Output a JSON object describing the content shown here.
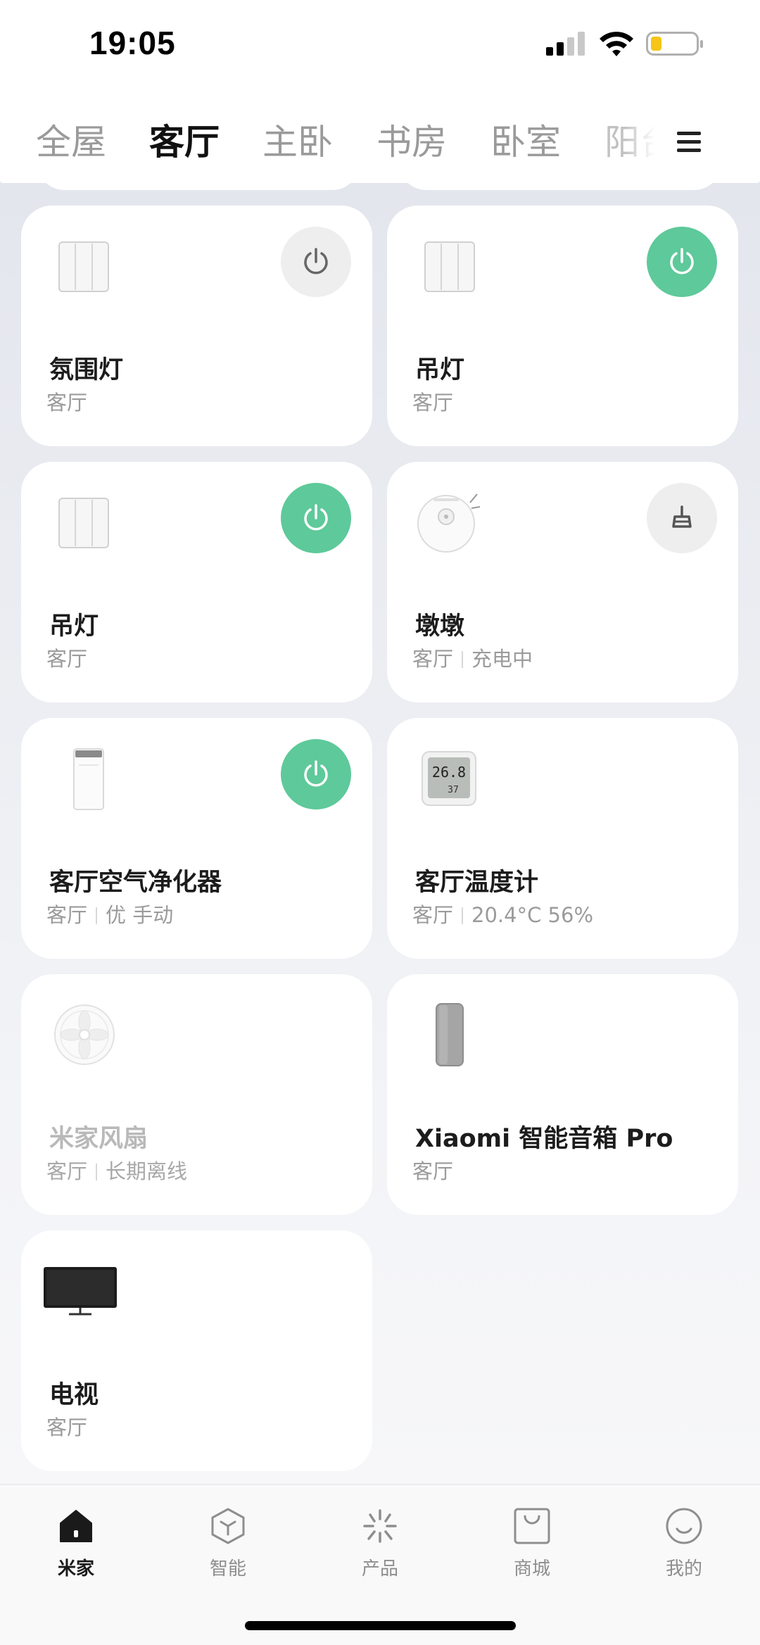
{
  "status_bar": {
    "time": "19:05"
  },
  "rooms": {
    "tabs": [
      {
        "label": "全屋"
      },
      {
        "label": "客厅"
      },
      {
        "label": "主卧"
      },
      {
        "label": "书房"
      },
      {
        "label": "卧室"
      },
      {
        "label": "阳台"
      }
    ],
    "active_index": 1
  },
  "devices": [
    {
      "name": "氛围灯",
      "room": "客厅",
      "status": "",
      "icon": "wall-switch-icon",
      "action": "power-off"
    },
    {
      "name": "吊灯",
      "room": "客厅",
      "status": "",
      "icon": "wall-switch-icon",
      "action": "power-on"
    },
    {
      "name": "吊灯",
      "room": "客厅",
      "status": "",
      "icon": "wall-switch-icon",
      "action": "power-on"
    },
    {
      "name": "墩墩",
      "room": "客厅",
      "status": "充电中",
      "icon": "robot-vacuum-icon",
      "action": "sweep"
    },
    {
      "name": "客厅空气净化器",
      "room": "客厅",
      "status": "优 手动",
      "icon": "air-purifier-icon",
      "action": "power-on"
    },
    {
      "name": "客厅温度计",
      "room": "客厅",
      "status": "20.4°C 56%",
      "icon": "thermometer-icon",
      "thermometer_display": [
        "26.8",
        "37"
      ],
      "action": "none"
    },
    {
      "name": "米家风扇",
      "room": "客厅",
      "status": "长期离线",
      "icon": "fan-icon",
      "action": "none",
      "offline": true
    },
    {
      "name": "Xiaomi 智能音箱 Pro",
      "room": "客厅",
      "status": "",
      "icon": "smart-speaker-icon",
      "action": "none"
    },
    {
      "name": "电视",
      "room": "客厅",
      "status": "",
      "icon": "tv-icon",
      "action": "none"
    }
  ],
  "bottom_nav": {
    "items": [
      {
        "label": "米家",
        "icon": "home-icon"
      },
      {
        "label": "智能",
        "icon": "cube-icon"
      },
      {
        "label": "产品",
        "icon": "sparkle-icon"
      },
      {
        "label": "商城",
        "icon": "shopping-bag-icon"
      },
      {
        "label": "我的",
        "icon": "smiley-icon"
      }
    ],
    "active_index": 0
  },
  "colors": {
    "accent_on": "#5ec99a",
    "button_off": "#eeeeee",
    "text_primary": "#1c1c1c",
    "text_secondary": "#9b9b9b"
  }
}
